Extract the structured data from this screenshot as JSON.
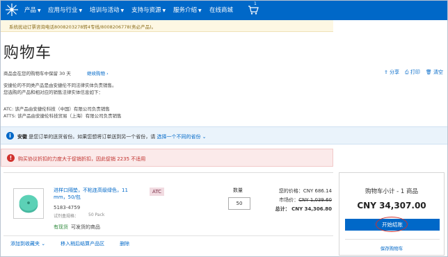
{
  "nav": {
    "items": [
      {
        "label": "产品",
        "chevron": true
      },
      {
        "label": "应用与行业",
        "chevron": true
      },
      {
        "label": "培训与活动",
        "chevron": true
      },
      {
        "label": "支持与资源",
        "chevron": true
      },
      {
        "label": "服务介绍",
        "chevron": true
      },
      {
        "label": "在线商城",
        "chevron": false
      }
    ],
    "cart_count": "1",
    "colors": {
      "bar": "#0068c8"
    }
  },
  "notice": "系统扰动订票咨询电话8008203278转4专线/8008206778(务必产品)。",
  "page_title": "购物车",
  "hold_text": "商品会在您的购物车中保留 30 天",
  "continue_link": "继续购物 ›",
  "actions": {
    "share": "分享",
    "print": "打印",
    "clear": "清空"
  },
  "info1": [
    "安捷伦的不同类产品是由安捷伦不同法律实体负责销售。",
    "您选购的产品和相对应的销售法律实体信息如下："
  ],
  "info2": [
    "ATC: 该产品由安捷伦科技（中国）有限公司负责销售",
    "ATTS: 该产品由安捷伦科技贸易（上海）有限公司负责销售"
  ],
  "shipping": {
    "icon": "info-icon",
    "bold": "安徽",
    "text": " 是您订单的送货省份。如果您想将订单送到另一个省份，请 ",
    "link": "选择一个不同的省份"
  },
  "warning": {
    "icon": "alert-icon",
    "text": "购买协议折扣的力度大于促销折扣，因此促销 2235 不适用"
  },
  "product": {
    "name": "进样口隔垫，不粘连高级绿色，11 mm，50/包",
    "part_number": "5183-4759",
    "pack_label": "试剂盒规格：",
    "pack": "50 Pack",
    "badge": "ATC",
    "qty_label": "数量",
    "qty": "50",
    "your_price_label": "您的价格：",
    "your_price": "CNY 686.14",
    "list_price_label": "市场价：",
    "list_price": "CNY 1,039.60",
    "total_label": "总计：",
    "total": "CNY 34,306.80",
    "stock": "有现货",
    "stock_note": "可发货的商品",
    "row_actions": {
      "fav": "添加到收藏夹 ⌄",
      "move": "移入稍后结算产品区",
      "delete": "删除"
    }
  },
  "summary": {
    "title": "购物车小计 - 1 商品",
    "total": "CNY 34,307.00",
    "checkout": "开始结账",
    "save": "保存购物车"
  }
}
